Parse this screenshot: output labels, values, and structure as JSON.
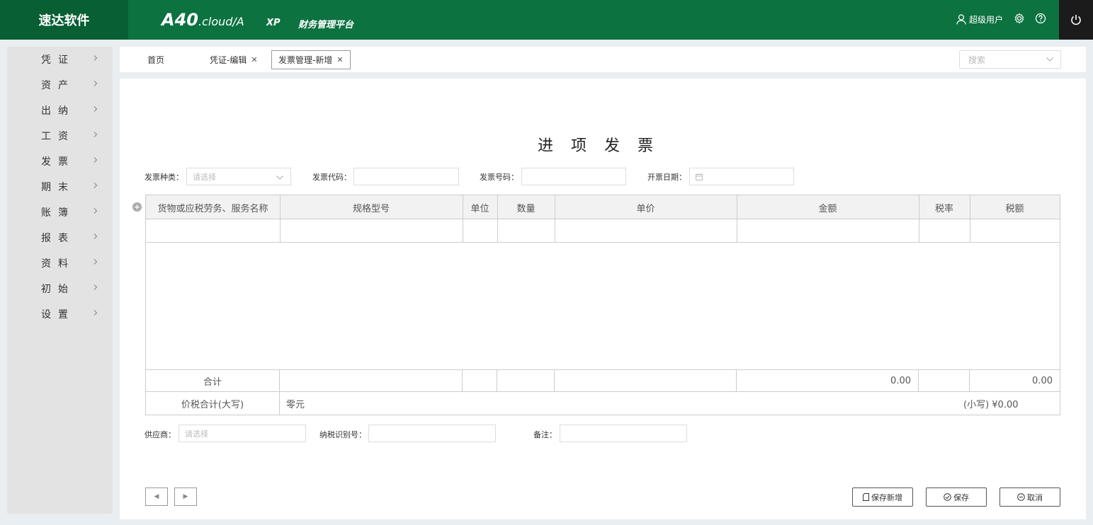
{
  "header": {
    "brand": "速达软件",
    "logo_main": "A40",
    "logo_suffix": ".cloud/A",
    "edition": "XP",
    "platform": "财务管理平台",
    "user": "超级用户"
  },
  "sidebar": {
    "items": [
      {
        "label": "凭证"
      },
      {
        "label": "资产"
      },
      {
        "label": "出纳"
      },
      {
        "label": "工资"
      },
      {
        "label": "发票"
      },
      {
        "label": "期末"
      },
      {
        "label": "账簿"
      },
      {
        "label": "报表"
      },
      {
        "label": "资料"
      },
      {
        "label": "初始"
      },
      {
        "label": "设置"
      }
    ]
  },
  "tabs": {
    "home": "首页",
    "tab1": "凭证-编辑",
    "tab2": "发票管理-新增",
    "search_placeholder": "搜索"
  },
  "form": {
    "title": "进 项 发 票",
    "invoice_type_label": "发票种类：",
    "invoice_type_placeholder": "请选择",
    "invoice_code_label": "发票代码：",
    "invoice_code_value": "",
    "invoice_no_label": "发票号码：",
    "invoice_no_value": "",
    "date_label": "开票日期：",
    "date_value": "",
    "supplier_label": "供应商：",
    "supplier_placeholder": "请选择",
    "tax_id_label": "纳税识别号：",
    "tax_id_value": "",
    "note_label": "备注：",
    "note_value": ""
  },
  "table": {
    "columns": [
      "货物或应税劳务、服务名称",
      "规格型号",
      "单位",
      "数量",
      "单价",
      "金额",
      "税率",
      "税额"
    ],
    "total_label": "合计",
    "total_amount": "0.00",
    "total_tax": "0.00",
    "capital_label": "价税合计(大写)",
    "capital_value": "零元",
    "small_value": "(小写) ¥0.00"
  },
  "buttons": {
    "save_new": "保存新增",
    "save": "保存",
    "cancel": "取消"
  }
}
